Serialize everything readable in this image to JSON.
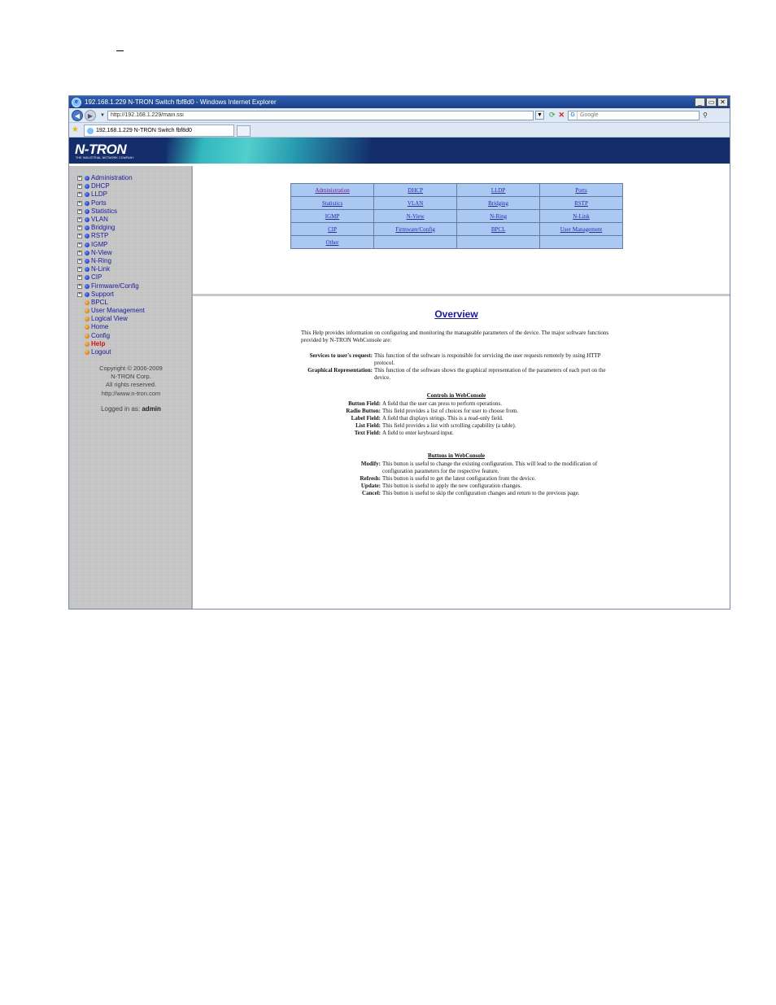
{
  "window": {
    "title": "192.168.1.229 N-TRON Switch fbf8d0 - Windows Internet Explorer",
    "min": "_",
    "max": "▭",
    "close": "✕"
  },
  "addressbar": {
    "url": "http://192.168.1.229/main.ssi",
    "search_placeholder": "Google"
  },
  "tab": {
    "label": "192.168.1.229 N-TRON Switch fbf8d0"
  },
  "banner": {
    "logo": "N-TRON",
    "tagline": "THE INDUSTRIAL NETWORK COMPANY"
  },
  "sidebar": {
    "items": [
      {
        "label": "Administration",
        "expandable": true,
        "dot": "blue"
      },
      {
        "label": "DHCP",
        "expandable": true,
        "dot": "blue"
      },
      {
        "label": "LLDP",
        "expandable": true,
        "dot": "blue"
      },
      {
        "label": "Ports",
        "expandable": true,
        "dot": "blue"
      },
      {
        "label": "Statistics",
        "expandable": true,
        "dot": "blue"
      },
      {
        "label": "VLAN",
        "expandable": true,
        "dot": "blue"
      },
      {
        "label": "Bridging",
        "expandable": true,
        "dot": "blue"
      },
      {
        "label": "RSTP",
        "expandable": true,
        "dot": "blue"
      },
      {
        "label": "IGMP",
        "expandable": true,
        "dot": "blue"
      },
      {
        "label": "N-View",
        "expandable": true,
        "dot": "blue"
      },
      {
        "label": "N-Ring",
        "expandable": true,
        "dot": "blue"
      },
      {
        "label": "N-Link",
        "expandable": true,
        "dot": "blue"
      },
      {
        "label": "CIP",
        "expandable": true,
        "dot": "blue"
      },
      {
        "label": "Firmware/Config",
        "expandable": true,
        "dot": "blue"
      },
      {
        "label": "Support",
        "expandable": true,
        "dot": "blue"
      },
      {
        "label": "BPCL",
        "expandable": false,
        "dot": "orange"
      },
      {
        "label": "User Management",
        "expandable": false,
        "dot": "orange"
      },
      {
        "label": "Logical View",
        "expandable": false,
        "dot": "orange"
      },
      {
        "label": "Home",
        "expandable": false,
        "dot": "orange"
      },
      {
        "label": "Config",
        "expandable": false,
        "dot": "orange"
      },
      {
        "label": "Help",
        "expandable": false,
        "dot": "orange",
        "active": true
      },
      {
        "label": "Logout",
        "expandable": false,
        "dot": "orange"
      }
    ],
    "copyright": [
      "Copyright © 2006-2009",
      "N-TRON Corp.",
      "All rights reserved.",
      "http://www.n-tron.com"
    ],
    "logged_in_prefix": "Logged in as:",
    "logged_in_user": "admin"
  },
  "link_table": [
    [
      "Administration",
      "DHCP",
      "LLDP",
      "Ports"
    ],
    [
      "Statistics",
      "VLAN",
      "Bridging",
      "RSTP"
    ],
    [
      "IGMP",
      "N-View",
      "N-Ring",
      "N-Link"
    ],
    [
      "CIP",
      "Firmware/Config",
      "BPCL",
      "User Management"
    ],
    [
      "Other",
      "",
      "",
      ""
    ]
  ],
  "help": {
    "title": "Overview",
    "intro": "This Help provides information on configuring and monitoring the manageable parameters of the device. The major software functions provided by N-TRON WebConsole are:",
    "functions": [
      {
        "term": "Services to user's request:",
        "def": "This function of the software is responsible for servicing the user requests remotely by using HTTP protocol."
      },
      {
        "term": "Graphical Representation:",
        "def": "This function of the software shows the graphical representation of the parameters of each port on the device."
      }
    ],
    "controls_title": "Controls in WebConsole",
    "controls": [
      {
        "term": "Button Field:",
        "def": "A field that the user can press to perform operations."
      },
      {
        "term": "Radio Button:",
        "def": "This field provides a list of choices for user to choose from."
      },
      {
        "term": "Label Field:",
        "def": "A field that displays strings. This is a read-only field."
      },
      {
        "term": "List Field:",
        "def": "This field provides a list with scrolling capability (a table)."
      },
      {
        "term": "Text Field:",
        "def": "A field to enter keyboard input."
      }
    ],
    "buttons_title": "Buttons in WebConsole",
    "buttons": [
      {
        "term": "Modify:",
        "def": "This button is useful to change the existing configuration. This will lead to the modification of configuration parameters for the respective feature."
      },
      {
        "term": "Refresh:",
        "def": "This button is useful to get the latest configuration from the device."
      },
      {
        "term": "Update:",
        "def": "This button is useful to apply the new configuration changes."
      },
      {
        "term": "Cancel:",
        "def": "This button is useful to skip the configuration changes and return to the previous page."
      }
    ]
  }
}
